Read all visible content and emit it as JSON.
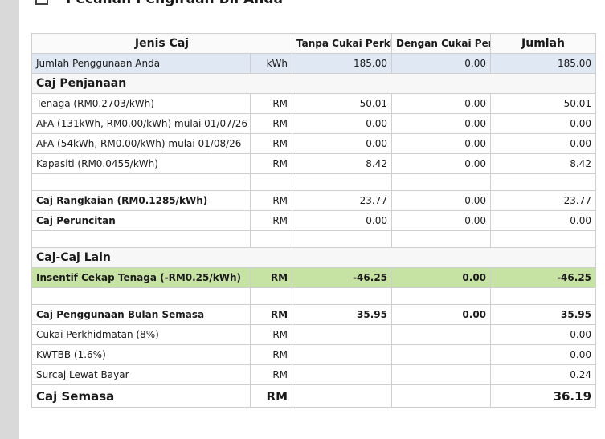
{
  "header": {
    "title": "Pecahan Pengiraan Bil Anda"
  },
  "table": {
    "columns": {
      "jenis": "Jenis Caj",
      "tanpa": "Tanpa Cukai Perkhidmatan",
      "dengan": "Dengan Cukai Perkhidmatan",
      "jumlah": "Jumlah"
    },
    "usage": {
      "label": "Jumlah Penggunaan Anda",
      "unit": "kWh",
      "tanpa": "185.00",
      "dengan": "0.00",
      "jumlah": "185.00"
    },
    "caj_penjanaan": {
      "title": "Caj Penjanaan",
      "rows": [
        {
          "label": "Tenaga (RM0.2703/kWh)",
          "unit": "RM",
          "tanpa": "50.01",
          "dengan": "0.00",
          "jumlah": "50.01"
        },
        {
          "label": "AFA (131kWh, RM0.00/kWh) mulai 01/07/26",
          "unit": "RM",
          "tanpa": "0.00",
          "dengan": "0.00",
          "jumlah": "0.00"
        },
        {
          "label": "AFA (54kWh, RM0.00/kWh) mulai 01/08/26",
          "unit": "RM",
          "tanpa": "0.00",
          "dengan": "0.00",
          "jumlah": "0.00"
        },
        {
          "label": "Kapasiti (RM0.0455/kWh)",
          "unit": "RM",
          "tanpa": "8.42",
          "dengan": "0.00",
          "jumlah": "8.42"
        }
      ]
    },
    "caj_rangkaian": {
      "label": "Caj Rangkaian (RM0.1285/kWh)",
      "unit": "RM",
      "tanpa": "23.77",
      "dengan": "0.00",
      "jumlah": "23.77"
    },
    "caj_peruncitan": {
      "label": "Caj Peruncitan",
      "unit": "RM",
      "tanpa": "0.00",
      "dengan": "0.00",
      "jumlah": "0.00"
    },
    "caj_lain": {
      "title": "Caj-Caj Lain"
    },
    "insentif": {
      "label": "Insentif Cekap Tenaga (-RM0.25/kWh)",
      "unit": "RM",
      "tanpa": "-46.25",
      "dengan": "0.00",
      "jumlah": "-46.25"
    },
    "bulan_semasa": {
      "label": "Caj Penggunaan Bulan Semasa",
      "unit": "RM",
      "tanpa": "35.95",
      "dengan": "0.00",
      "jumlah": "35.95"
    },
    "cukai": {
      "label": "Cukai Perkhidmatan (8%)",
      "unit": "RM",
      "jumlah": "0.00"
    },
    "kwtbb": {
      "label": "KWTBB (1.6%)",
      "unit": "RM",
      "jumlah": "0.00"
    },
    "surcaj": {
      "label": "Surcaj Lewat Bayar",
      "unit": "RM",
      "jumlah": "0.24"
    },
    "total": {
      "label": "Caj Semasa",
      "unit": "RM",
      "jumlah": "36.19"
    }
  }
}
